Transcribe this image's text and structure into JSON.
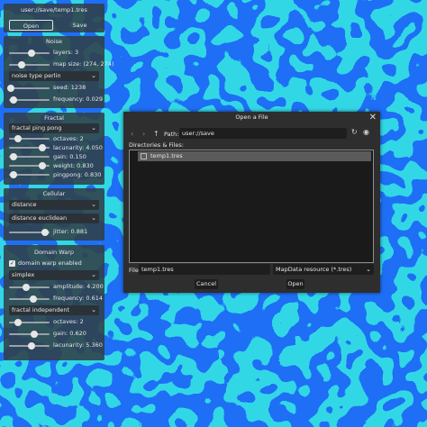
{
  "file_bar": {
    "path": "user://save/temp1.tres",
    "open_label": "Open",
    "save_label": "Save"
  },
  "noise": {
    "title": "Noise",
    "layers_label": "layers: 3",
    "layers_fraction": 0.55,
    "map_size_label": "map size: (274, 274)",
    "map_size_fraction": 0.3,
    "noise_type": "noise type perlin",
    "seed_label": "seed: 1238",
    "seed_fraction": 0.05,
    "frequency_label": "frequency: 0.029",
    "frequency_fraction": 0.12
  },
  "fractal": {
    "title": "Fractal",
    "fractal_type": "fractal ping pong",
    "octaves_label": "octaves: 2",
    "octaves_fraction": 0.22,
    "lacunarity_label": "lacunarity: 4.050",
    "lacunarity_fraction": 0.82,
    "gain_label": "gain: 0.150",
    "gain_fraction": 0.12,
    "weight_label": "weight: 0.830",
    "weight_fraction": 0.83,
    "pingpong_label": "pingpong: 0.830",
    "pingpong_fraction": 0.1
  },
  "cellular": {
    "title": "Cellular",
    "distance_function": "distance",
    "return_type": "distance euclidean",
    "jitter_label": "jitter: 0.881",
    "jitter_fraction": 0.88
  },
  "domain_warp": {
    "title": "Domain Warp",
    "enabled_label": "domain warp enabled",
    "enabled": true,
    "warp_type": "simplex",
    "amplitude_label": "amplitude: 4.200",
    "amplitude_fraction": 0.42,
    "frequency_label": "frequency: 0.614",
    "frequency_fraction": 0.61,
    "fractal_type": "fractal independent",
    "octaves_label": "octaves: 2",
    "octaves_fraction": 0.22,
    "gain_label": "gain: 0.620",
    "gain_fraction": 0.62,
    "lacunarity_label": "lacunarity: 5.360",
    "lacunarity_fraction": 0.55
  },
  "dialog": {
    "title": "Open a File",
    "path_label": "Path:",
    "path_value": "user://save",
    "dirs_label": "Directories & Files:",
    "files": [
      "temp1.tres"
    ],
    "file_label": "File:",
    "file_value": "temp1.tres",
    "filter_value": "MapData resource (*.tres)",
    "cancel_label": "Cancel",
    "open_label": "Open"
  },
  "icons": {
    "close": "close-icon",
    "back": "back-arrow-icon",
    "forward": "forward-arrow-icon",
    "up": "up-arrow-icon",
    "refresh": "refresh-icon",
    "toggle_hidden": "eye-icon",
    "file": "file-icon",
    "chevron": "chevron-down-icon"
  },
  "colors": {
    "noise_light": "#31d7e6",
    "noise_dark": "#1e6ff5",
    "panel": "#304048",
    "dialog": "#2e2e2e"
  }
}
